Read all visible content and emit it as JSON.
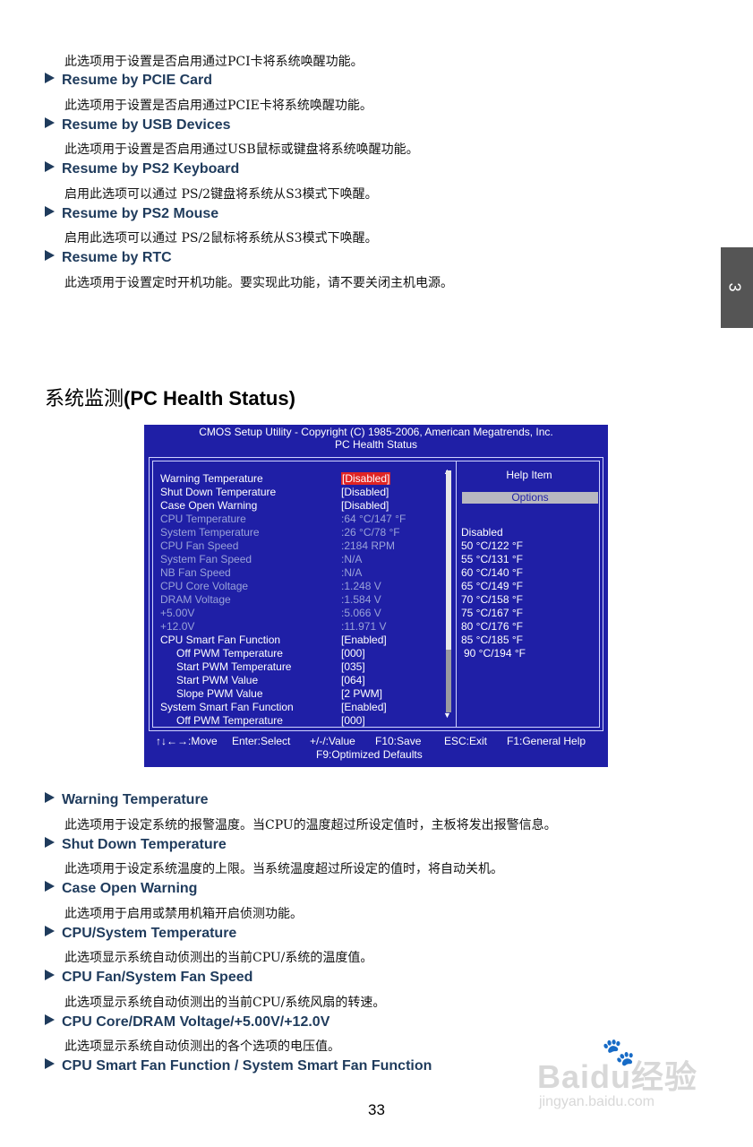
{
  "top": {
    "pci_desc": "此选项用于设置是否启用通过PCI卡将系统唤醒功能。",
    "items": [
      {
        "title": "Resume by PCIE Card",
        "desc": "此选项用于设置是否启用通过PCIE卡将系统唤醒功能。"
      },
      {
        "title": "Resume by USB Devices",
        "desc": "此选项用于设置是否启用通过USB鼠标或键盘将系统唤醒功能。"
      },
      {
        "title": "Resume by PS2 Keyboard",
        "desc": "启用此选项可以通过 PS/2键盘将系统从S3模式下唤醒。"
      },
      {
        "title": "Resume by PS2 Mouse",
        "desc": "启用此选项可以通过 PS/2鼠标将系统从S3模式下唤醒。"
      },
      {
        "title": "Resume by RTC",
        "desc": "此选项用于设置定时开机功能。要实现此功能，请不要关闭主机电源。"
      }
    ]
  },
  "chapter_tab": "3",
  "section": {
    "title_cn": "系统监测",
    "title_en": "(PC Health Status)"
  },
  "bios": {
    "header_line1": "CMOS Setup Utility - Copyright (C) 1985-2006, American Megatrends, Inc.",
    "header_line2": "PC Health Status",
    "rows": [
      {
        "label": "Warning Temperature",
        "value": "[Disabled]"
      },
      {
        "label": "Shut Down Temperature",
        "value": "[Disabled]"
      },
      {
        "label": "Case Open Warning",
        "value": "[Disabled]"
      },
      {
        "label": "CPU Temperature",
        "value": ":64 °C/147 °F"
      },
      {
        "label": "System Temperature",
        "value": ":26 °C/78 °F"
      },
      {
        "label": "CPU Fan Speed",
        "value": ":2184 RPM"
      },
      {
        "label": "System Fan Speed",
        "value": ":N/A"
      },
      {
        "label": "NB Fan Speed",
        "value": ":N/A"
      },
      {
        "label": "CPU Core Voltage",
        "value": ":1.248 V"
      },
      {
        "label": "DRAM Voltage",
        "value": ":1.584 V"
      },
      {
        "label": "+5.00V",
        "value": ":5.066 V"
      },
      {
        "label": "+12.0V",
        "value": ":11.971 V"
      },
      {
        "label": "CPU Smart Fan Function",
        "value": "[Enabled]"
      },
      {
        "label": "Off PWM Temperature",
        "value": "[000]"
      },
      {
        "label": "Start PWM Temperature",
        "value": "[035]"
      },
      {
        "label": "Start PWM Value",
        "value": "[064]"
      },
      {
        "label": "Slope PWM Value",
        "value": "[2 PWM]"
      },
      {
        "label": "System Smart Fan Function",
        "value": "[Enabled]"
      },
      {
        "label": "Off PWM Temperature",
        "value": "[000]"
      }
    ],
    "help_title": "Help Item",
    "options_label": "Options",
    "options": [
      "Disabled",
      "50 °C/122 °F",
      "55 °C/131 °F",
      "60 °C/140 °F",
      "65 °C/149 °F",
      "70 °C/158 °F",
      "75 °C/167 °F",
      "80 °C/176 °F",
      "85 °C/185 °F",
      "90 °C/194 °F"
    ],
    "footer": {
      "move": "↑↓←→:Move",
      "enter": "Enter:Select",
      "value": "+/-/:Value",
      "save": "F10:Save",
      "exit": "ESC:Exit",
      "help": "F1:General Help",
      "defaults": "F9:Optimized  Defaults"
    },
    "colors": {
      "background": "#1f1fa6",
      "selected": "#e02424",
      "disabled_text": "#9aa3d9"
    }
  },
  "bottom": {
    "items": [
      {
        "title": "Warning Temperature",
        "desc": "此选项用于设定系统的报警温度。当CPU的温度超过所设定值时，主板将发出报警信息。"
      },
      {
        "title": "Shut Down Temperature",
        "desc": "此选项用于设定系统温度的上限。当系统温度超过所设定的值时，将自动关机。"
      },
      {
        "title": "Case Open Warning",
        "desc": "此选项用于启用或禁用机箱开启侦测功能。"
      },
      {
        "title": "CPU/System Temperature",
        "desc": "此选项显示系统自动侦测出的当前CPU/系统的温度值。"
      },
      {
        "title": "CPU Fan/System Fan Speed",
        "desc": "此选项显示系统自动侦测出的当前CPU/系统风扇的转速。"
      },
      {
        "title": "CPU Core/DRAM Voltage/+5.00V/+12.0V",
        "desc": "此选项显示系统自动侦测出的各个选项的电压值。"
      },
      {
        "title": "CPU Smart Fan Function / System Smart Fan Function",
        "desc": ""
      }
    ]
  },
  "page_number": "33",
  "watermark": {
    "brand": "Baidu经验",
    "url": "jingyan.baidu.com"
  }
}
